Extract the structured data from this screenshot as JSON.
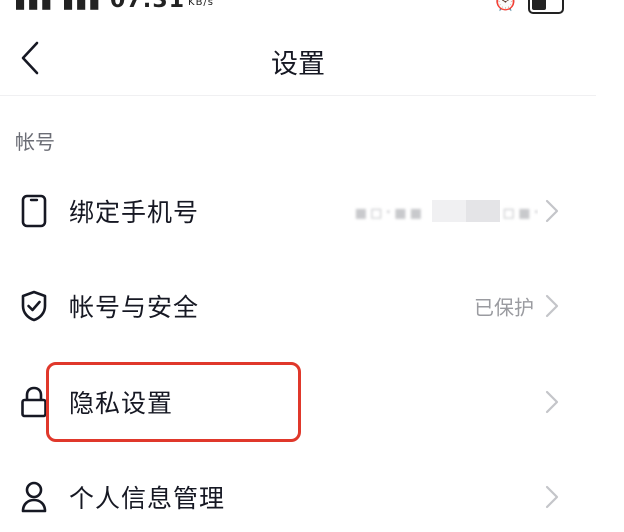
{
  "status_bar": {
    "time": "07:31",
    "network_speed": "KB/s"
  },
  "header": {
    "title": "设置"
  },
  "section": {
    "title": "帐号"
  },
  "rows": [
    {
      "label": "绑定手机号",
      "value": ""
    },
    {
      "label": "帐号与安全",
      "value": "已保护"
    },
    {
      "label": "隐私设置",
      "value": ""
    },
    {
      "label": "个人信息管理",
      "value": ""
    }
  ],
  "colors": {
    "highlight": "#e0382b",
    "text": "#161823",
    "secondary": "#9a9ba0",
    "chevron": "#c4c5c9"
  },
  "icons": {
    "back": "chevron-left-icon",
    "phone": "phone-icon",
    "account": "shield-check-icon",
    "privacy": "lock-icon",
    "personal": "user-icon",
    "chevron": "chevron-right-icon"
  }
}
